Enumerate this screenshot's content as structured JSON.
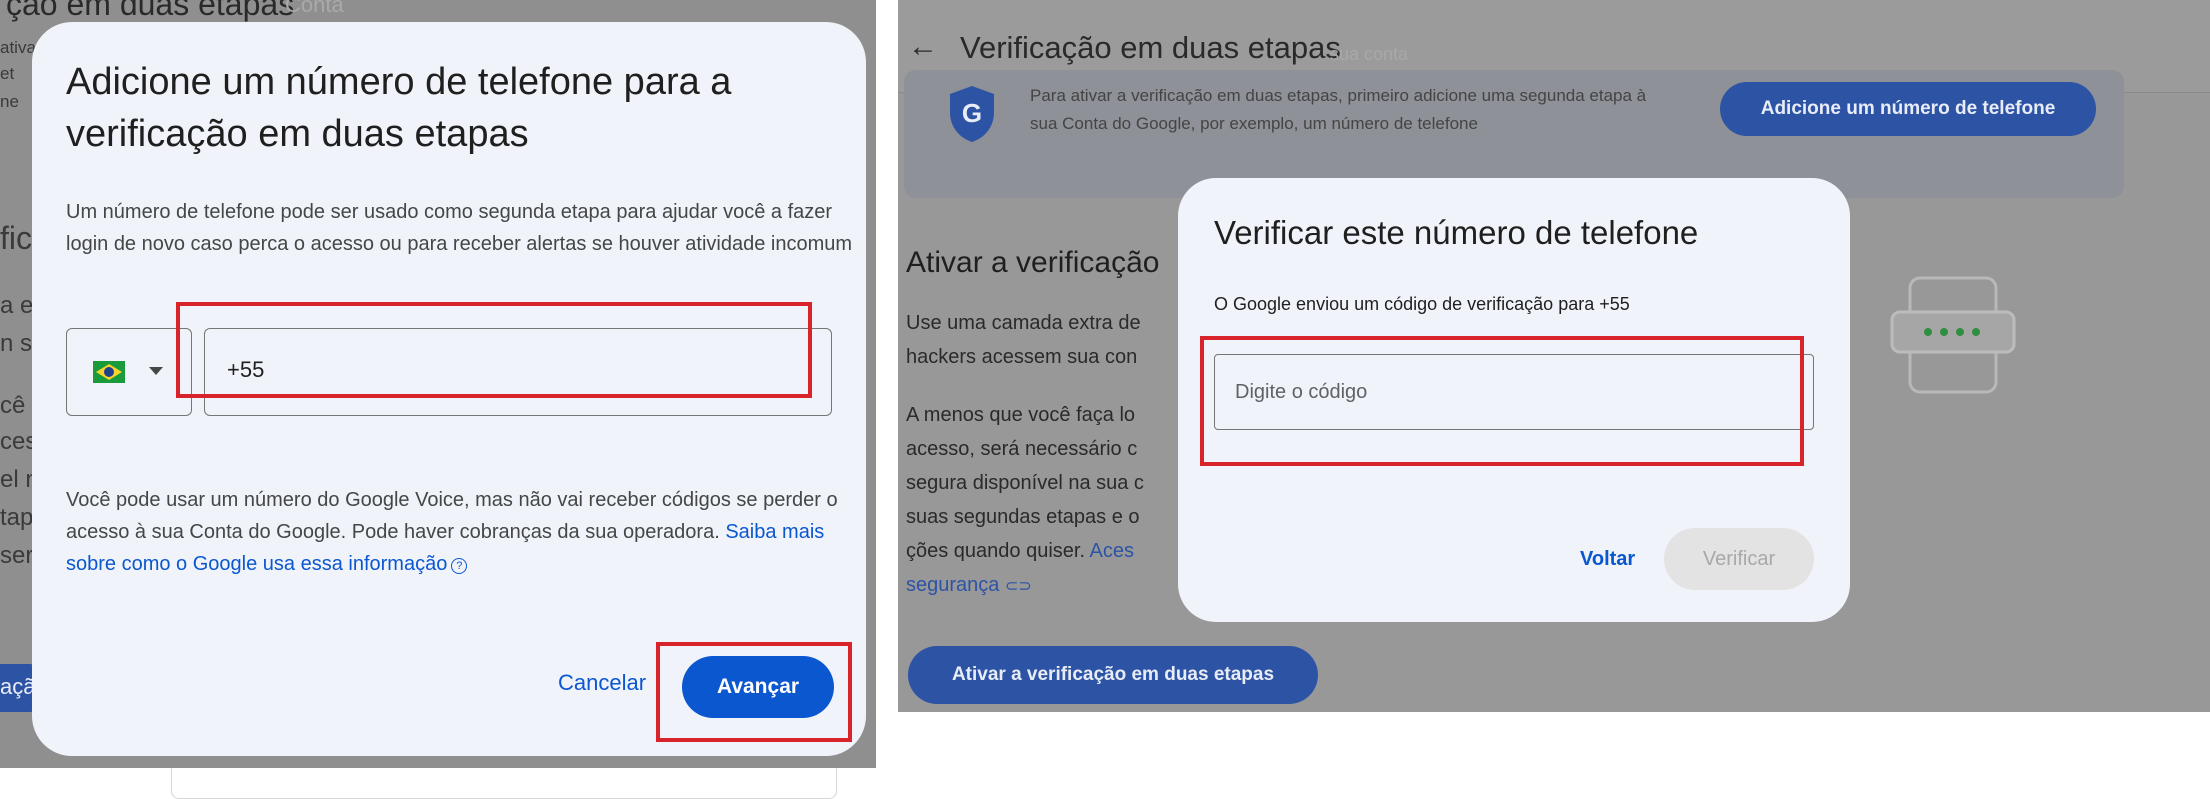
{
  "left": {
    "background": {
      "title": "ção em duas etapas",
      "title_faint": "Conta",
      "fragments": [
        "ativa",
        "et",
        "ne",
        "fic",
        "a e",
        "n s",
        "cê",
        "ces",
        "el n",
        "tap",
        "ser"
      ],
      "button_fragment": "açã"
    },
    "dialog": {
      "title": "Adicione um número de telefone para a verificação em duas etapas",
      "description": "Um número de telefone pode ser usado como segunda etapa para ajudar você a fazer login de novo caso perca o acesso ou para receber alertas se houver atividade incomum",
      "country": {
        "flag": "brazil-flag-icon"
      },
      "phone_value": "+55",
      "note": "Você pode usar um número do Google Voice, mas não vai receber códigos se perder o acesso à sua Conta do Google. Pode haver cobranças da sua operadora.",
      "link": "Saiba mais sobre como o Google usa essa informação",
      "help_glyph": "?",
      "cancel_label": "Cancelar",
      "next_label": "Avançar"
    }
  },
  "right": {
    "header": {
      "back_glyph": "←",
      "title": "Verificação em duas etapas",
      "title_faint": "sua conta"
    },
    "info_card": {
      "text": "Para ativar a verificação em duas etapas, primeiro adicione uma segunda etapa à sua Conta do Google, por exemplo, um número de telefone",
      "button_label": "Adicione um número de telefone"
    },
    "section": {
      "title": "Ativar a verificação",
      "body_1": "Use uma camada extra de hackers acessem sua con",
      "body_2": "A menos que você faça lo acesso, será necessário c segura disponível na sua c suas segundas etapas e o ções quando quiser.",
      "link": "Aces segurança",
      "link_glyph": "⊂⊃"
    },
    "enable_button_label": "Ativar a verificação em duas etapas",
    "dialog": {
      "title": "Verificar este número de telefone",
      "description": "O Google enviou um código de verificação para +55",
      "code_placeholder": "Digite o código",
      "back_label": "Voltar",
      "verify_label": "Verificar"
    }
  },
  "colors": {
    "highlight": "#d9232a",
    "primary": "#0b57d0",
    "dialog_bg": "#f0f3f9",
    "overlay": "#8f8f8f"
  }
}
